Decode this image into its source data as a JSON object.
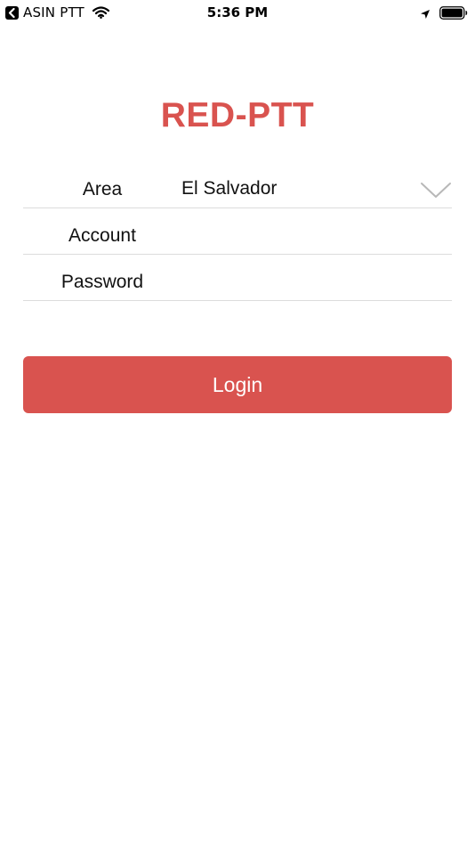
{
  "status_bar": {
    "back_app": "ASIN PTT",
    "time": "5:36 PM",
    "icons": [
      "back-icon",
      "wifi-icon",
      "location-arrow-icon",
      "battery-icon"
    ]
  },
  "app": {
    "title": "RED-PTT",
    "accent_color": "#d9534f"
  },
  "form": {
    "area": {
      "label": "Area",
      "value": "El Salvador"
    },
    "account": {
      "label": "Account",
      "value": ""
    },
    "password": {
      "label": "Password",
      "value": ""
    }
  },
  "actions": {
    "login_label": "Login"
  }
}
